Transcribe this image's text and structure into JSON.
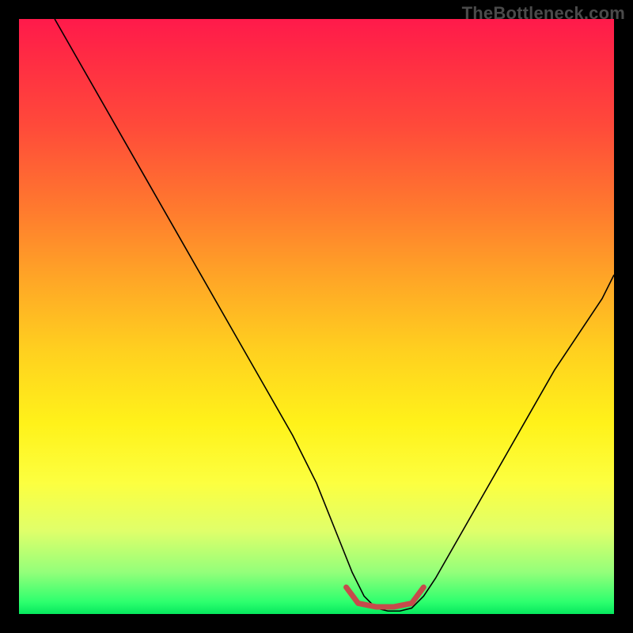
{
  "watermark": {
    "text": "TheBottleneck.com"
  },
  "chart_data": {
    "type": "line",
    "title": "",
    "xlabel": "",
    "ylabel": "",
    "xlim": [
      0,
      100
    ],
    "ylim": [
      0,
      100
    ],
    "background_gradient": {
      "direction": "vertical",
      "stops": [
        {
          "pos": 0,
          "color": "#ff1a4b"
        },
        {
          "pos": 18,
          "color": "#ff4a3a"
        },
        {
          "pos": 44,
          "color": "#ffa726"
        },
        {
          "pos": 68,
          "color": "#fff21a"
        },
        {
          "pos": 86,
          "color": "#e0ff6a"
        },
        {
          "pos": 100,
          "color": "#06e85e"
        }
      ]
    },
    "series": [
      {
        "name": "bottleneck-curve",
        "color": "#000000",
        "stroke_width": 1.6,
        "x": [
          6,
          10,
          14,
          18,
          22,
          26,
          30,
          34,
          38,
          42,
          46,
          50,
          52,
          54,
          56,
          58,
          60,
          62,
          64,
          66,
          68,
          70,
          74,
          78,
          82,
          86,
          90,
          94,
          98,
          100
        ],
        "y": [
          100,
          93,
          86,
          79,
          72,
          65,
          58,
          51,
          44,
          37,
          30,
          22,
          17,
          12,
          7,
          3,
          1,
          0.5,
          0.5,
          1,
          3,
          6,
          13,
          20,
          27,
          34,
          41,
          47,
          53,
          57
        ]
      },
      {
        "name": "optimal-zone",
        "color": "#c64b4b",
        "stroke_width": 7,
        "linecap": "round",
        "x": [
          55,
          57,
          60,
          63,
          66,
          68
        ],
        "y": [
          4.5,
          1.8,
          1.2,
          1.2,
          1.8,
          4.5
        ]
      }
    ]
  }
}
